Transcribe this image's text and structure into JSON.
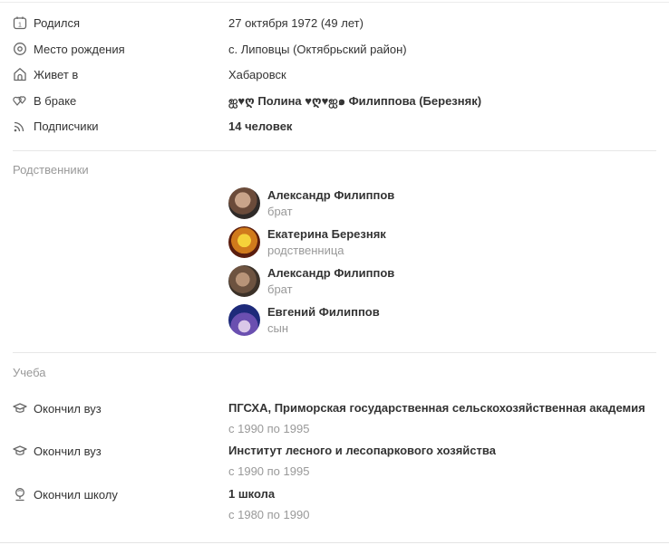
{
  "info": {
    "born": {
      "label": "Родился",
      "value": "27 октября 1972 (49 лет)",
      "icon": "calendar-icon"
    },
    "birthplace": {
      "label": "Место рождения",
      "value": "с. Липовцы (Октябрьский район)",
      "icon": "location-pin-icon"
    },
    "lives": {
      "label": "Живет в",
      "value": "Хабаровск",
      "icon": "home-icon"
    },
    "married": {
      "label": "В браке",
      "value": "ஐ♥ღ Полина ♥ღ♥ஐ๑ Филиппова (Березняк)",
      "icon": "hearts-icon"
    },
    "subscribers": {
      "label": "Подписчики",
      "value": "14 человек",
      "icon": "rss-icon"
    }
  },
  "relatives": {
    "title": "Родственники",
    "items": [
      {
        "name": "Александр Филиппов",
        "role": "брат"
      },
      {
        "name": "Екатерина Березняк",
        "role": "родственница"
      },
      {
        "name": "Александр Филиппов",
        "role": "брат"
      },
      {
        "name": "Евгений Филиппов",
        "role": "сын"
      }
    ]
  },
  "education": {
    "title": "Учеба",
    "items": [
      {
        "label": "Окончил вуз",
        "name": "ПГСХА, Приморская государственная сельскохозяйственная академия",
        "period": "с 1990 по 1995",
        "icon": "graduation-cap-icon"
      },
      {
        "label": "Окончил вуз",
        "name": "Институт лесного и лесопаркового хозяйства",
        "period": "с 1990 по 1995",
        "icon": "graduation-cap-icon"
      },
      {
        "label": "Окончил школу",
        "name": "1 школа",
        "period": "с 1980 по 1990",
        "icon": "school-icon"
      }
    ]
  },
  "colors": {
    "text": "#333333",
    "muted": "#999999",
    "icon": "#666666",
    "separator": "#e7e7e7"
  }
}
